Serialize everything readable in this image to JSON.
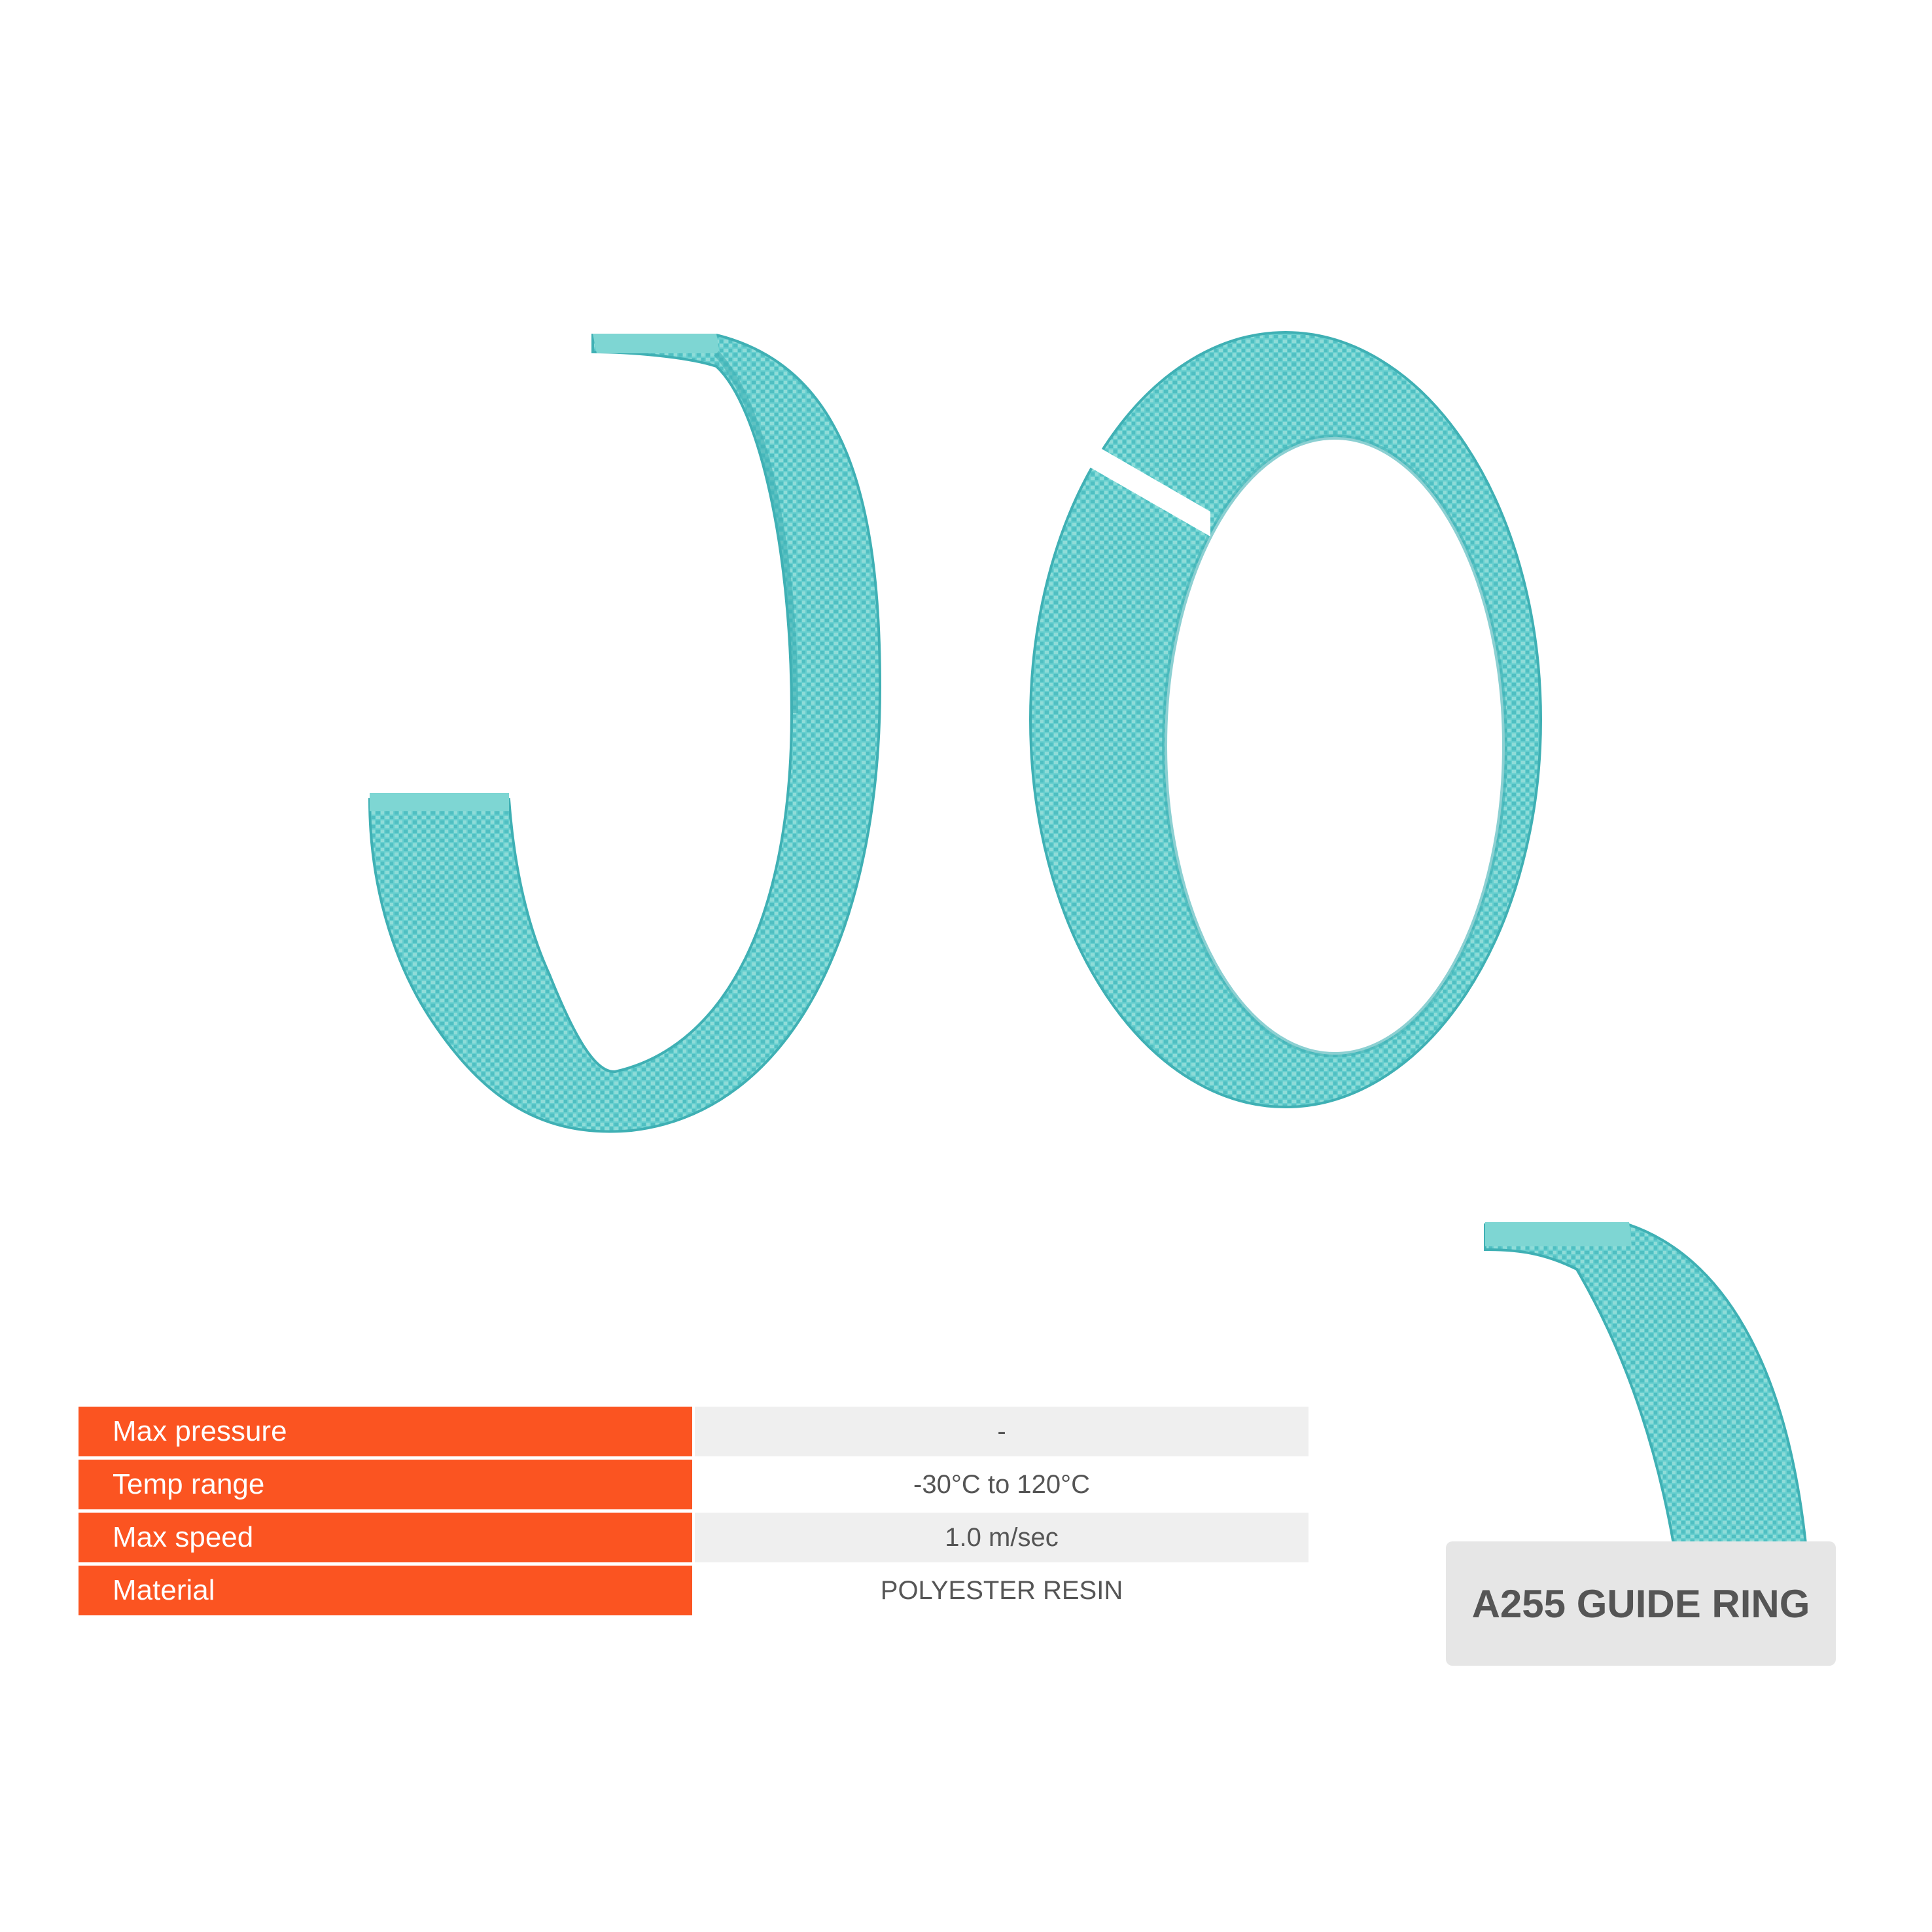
{
  "colors": {
    "accent": "#fb5421",
    "ring": "#68cfcf",
    "ring_dark": "#3fb0b4",
    "ring_light": "#9fe3e0",
    "value_shade": "#efefef",
    "badge_bg": "#e6e6e6",
    "text": "#555555"
  },
  "product": {
    "name": "A255 GUIDE RING"
  },
  "specs": [
    {
      "label": "Max pressure",
      "value": "-"
    },
    {
      "label": "Temp range",
      "value": "-30°C to 120°C"
    },
    {
      "label": "Max speed",
      "value": "1.0 m/sec"
    },
    {
      "label": "Material",
      "value": "POLYESTER RESIN"
    }
  ]
}
